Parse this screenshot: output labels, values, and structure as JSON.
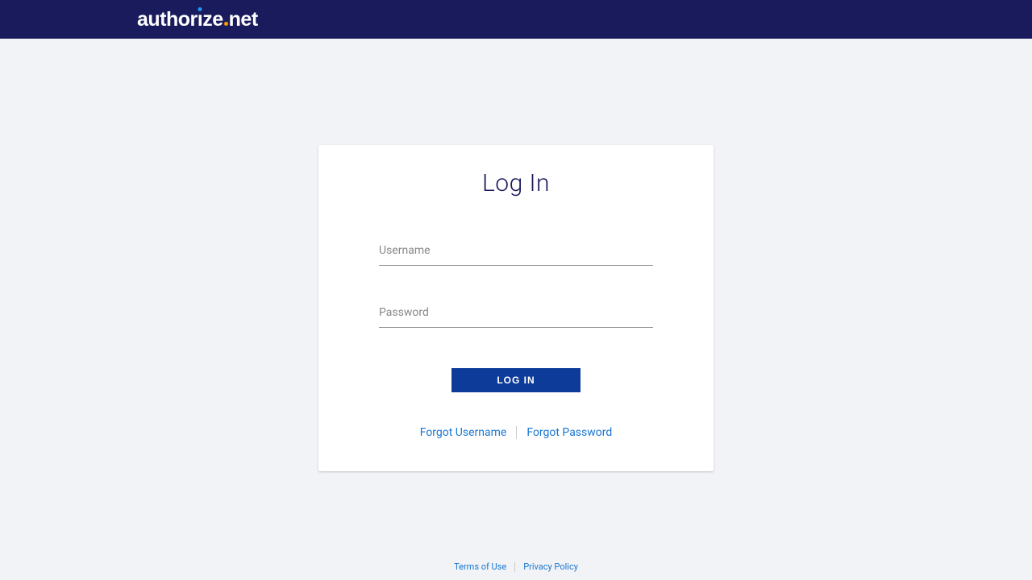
{
  "brand": {
    "part1": "author",
    "part2_letter": "ı",
    "part3": "ze",
    "part4": "net"
  },
  "login": {
    "title": "Log In",
    "username_label": "Username",
    "password_label": "Password",
    "button_label": "LOG IN",
    "forgot_username": "Forgot Username",
    "forgot_password": "Forgot Password"
  },
  "footer": {
    "terms": "Terms of Use",
    "privacy": "Privacy Policy"
  }
}
